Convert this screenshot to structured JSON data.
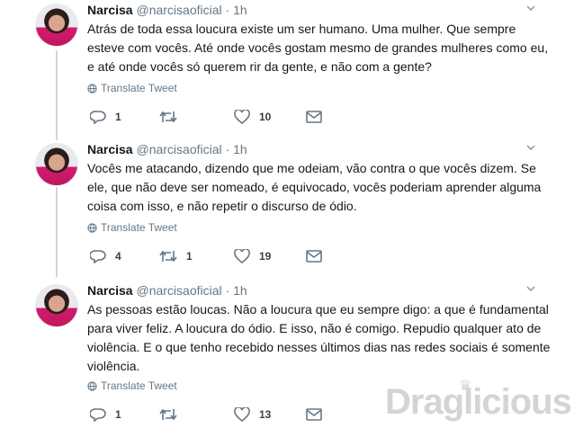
{
  "tweets": [
    {
      "name": "Narcisa",
      "handle": "@narcisaoficial",
      "separator": "·",
      "time": "1h",
      "text": "Atrás de toda essa loucura existe um ser humano. Uma mulher. Que sempre esteve com vocês. Até onde vocês gostam mesmo de grandes mulheres como eu, e até onde vocês só querem rir da gente, e não com a gente?",
      "translate": "Translate Tweet",
      "replies": "1",
      "retweets": "",
      "likes": "10"
    },
    {
      "name": "Narcisa",
      "handle": "@narcisaoficial",
      "separator": "·",
      "time": "1h",
      "text": "Vocês me atacando, dizendo que me odeiam, vão contra o que vocês dizem. Se ele, que não deve ser nomeado, é equivocado, vocês poderiam aprender alguma coisa com isso, e não repetir o discurso de ódio.",
      "translate": "Translate Tweet",
      "replies": "4",
      "retweets": "1",
      "likes": "19"
    },
    {
      "name": "Narcisa",
      "handle": "@narcisaoficial",
      "separator": "·",
      "time": "1h",
      "text": "As pessoas estão loucas. Não a loucura que eu sempre digo: a que é fundamental para viver feliz. A loucura do ódio. E isso, não é comigo. Repudio qualquer ato de violência. E o que tenho recebido nesses últimos dias nas redes sociais é somente violência.",
      "translate": "Translate Tweet",
      "replies": "1",
      "retweets": "",
      "likes": "13"
    }
  ],
  "watermark": "Draglicious",
  "icons": {
    "reply": "reply-icon",
    "retweet": "retweet-icon",
    "like": "heart-icon",
    "dm": "envelope-icon",
    "translate": "globe-icon",
    "more": "chevron-down-icon"
  },
  "colors": {
    "text": "#14171a",
    "secondary": "#657786",
    "thread_line": "#ccd6dd"
  }
}
